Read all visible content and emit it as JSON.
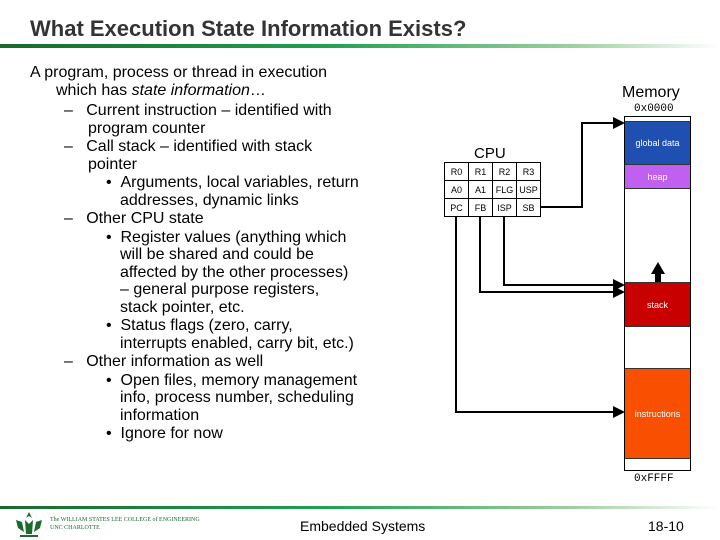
{
  "title": "What Execution State Information Exists?",
  "intro": "A program, process or thread in execution which has ",
  "intro_em": "state information",
  "intro_end": "…",
  "bullets": [
    {
      "level": 1,
      "text": "Current instruction – identified with program counter"
    },
    {
      "level": 1,
      "text": "Call stack – identified with stack pointer"
    },
    {
      "level": 2,
      "text": "Arguments, local variables, return addresses, dynamic links"
    },
    {
      "level": 1,
      "text": "Other CPU state"
    },
    {
      "level": 2,
      "text": "Register values (anything which will be shared and could be affected by the other processes) – general purpose registers, stack pointer, etc."
    },
    {
      "level": 2,
      "text": "Status flags (zero, carry, interrupts enabled, carry bit, etc.)"
    },
    {
      "level": 1,
      "text": "Other information as well"
    },
    {
      "level": 2,
      "text": "Open files, memory management info, process number, scheduling information"
    },
    {
      "level": 2,
      "text": "Ignore for now"
    }
  ],
  "diagram": {
    "cpu_label": "CPU",
    "registers": [
      [
        "R0",
        "R1",
        "R2",
        "R3"
      ],
      [
        "A0",
        "A1",
        "FLG",
        "USP"
      ],
      [
        "PC",
        "FB",
        "ISP",
        "SB"
      ]
    ],
    "memory_label": "Memory",
    "addr_top": "0x0000",
    "addr_bottom": "0xFFFF",
    "segments": {
      "global": "global data",
      "heap": "heap",
      "stack": "stack",
      "instructions": "instructions"
    },
    "colors": {
      "global": "#1f4fb0",
      "heap": "#c060f0",
      "stack": "#c80000",
      "instructions": "#f85000"
    }
  },
  "footer": {
    "course": "Embedded Systems",
    "page": "18-10",
    "logo_line1": "The WILLIAM STATES LEE COLLEGE of ENGINEERING",
    "logo_line2": "UNC CHARLOTTE"
  }
}
